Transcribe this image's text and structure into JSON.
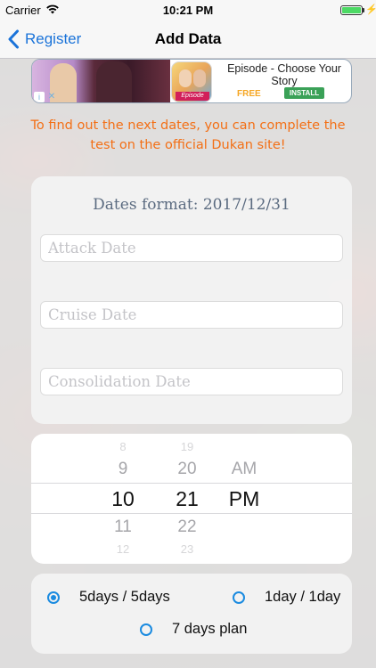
{
  "status_bar": {
    "carrier": "Carrier",
    "time": "10:21 PM",
    "wifi_icon": "wifi-icon",
    "battery_icon": "battery-icon",
    "charging_icon": "lightning-icon",
    "charge_symbol": "⚡"
  },
  "nav": {
    "back_label": "Register",
    "title": "Add Data",
    "accent": "#1a73d9"
  },
  "ad": {
    "title": "Episode - Choose Your Story",
    "free_label": "FREE",
    "install_label": "INSTALL",
    "app_tag": "Episode",
    "info_symbol": "i",
    "close_symbol": "✕"
  },
  "info_text": "To find out the next dates, you can complete the test on the official Dukan site!",
  "form": {
    "dates_format": "Dates format: 2017/12/31",
    "attack": {
      "placeholder": "Attack Date",
      "value": ""
    },
    "cruise": {
      "placeholder": "Cruise Date",
      "value": ""
    },
    "consolidation": {
      "placeholder": "Consolidation Date",
      "value": ""
    }
  },
  "picker": {
    "hours": [
      "8",
      "9",
      "10",
      "11",
      "12"
    ],
    "minutes": [
      "19",
      "20",
      "21",
      "22",
      "23"
    ],
    "ampm": [
      "AM",
      "PM"
    ],
    "selected": {
      "hour": "10",
      "minute": "21",
      "ampm": "PM"
    }
  },
  "plans": {
    "options": [
      {
        "label": "5days / 5days",
        "checked": true
      },
      {
        "label": "1day / 1day",
        "checked": false
      },
      {
        "label": "7 days plan",
        "checked": false
      }
    ],
    "accent": "#1b8be0"
  },
  "colors": {
    "info_text": "#f36f15",
    "dates_format_text": "#5b6b80"
  }
}
